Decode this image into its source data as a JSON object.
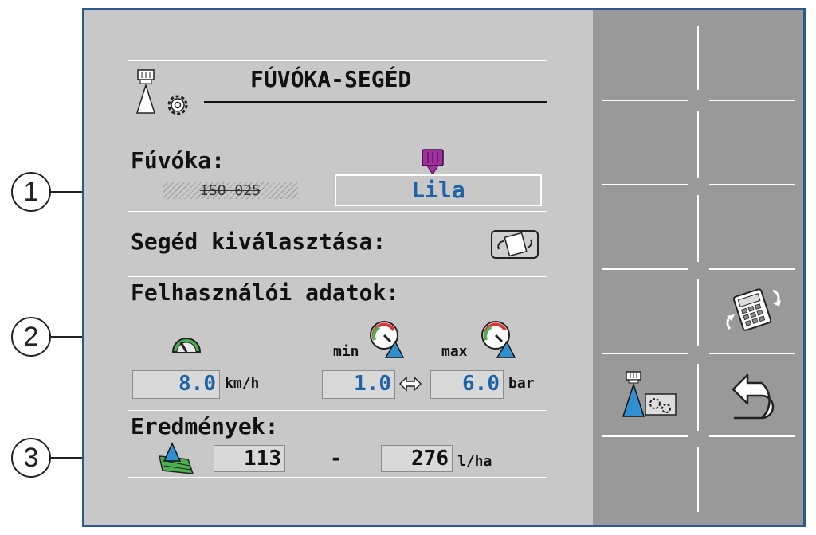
{
  "title": "FÚVÓKA-SEGÉD",
  "nozzle": {
    "label": "Fúvóka:",
    "iso_code": "ISO 025",
    "value": "Lila",
    "color": "#a030a0"
  },
  "assistant": {
    "label": "Segéd kiválasztása:"
  },
  "user_data": {
    "label": "Felhasználói adatok:",
    "speed_value": "8.0",
    "speed_unit": "km/h",
    "min_label": "min",
    "max_label": "max",
    "min_value": "1.0",
    "max_value": "6.0",
    "pressure_unit": "bar"
  },
  "results": {
    "label": "Eredmények:",
    "min_value": "113",
    "separator": "-",
    "max_value": "276",
    "unit": "l/ha"
  },
  "callouts": [
    "1",
    "2",
    "3"
  ],
  "softkeys": [
    {
      "name": "calculator-icon"
    },
    {
      "name": "nozzle-settings-icon"
    },
    {
      "name": "back-icon"
    }
  ],
  "colors": {
    "screen_bg": "#c8c8c8",
    "softkey_bg": "#999999",
    "value_blue": "#1e63a8",
    "frame_blue": "#2a5b8a",
    "drop_blue": "#2f8fd0",
    "field_green": "#4caf50"
  }
}
